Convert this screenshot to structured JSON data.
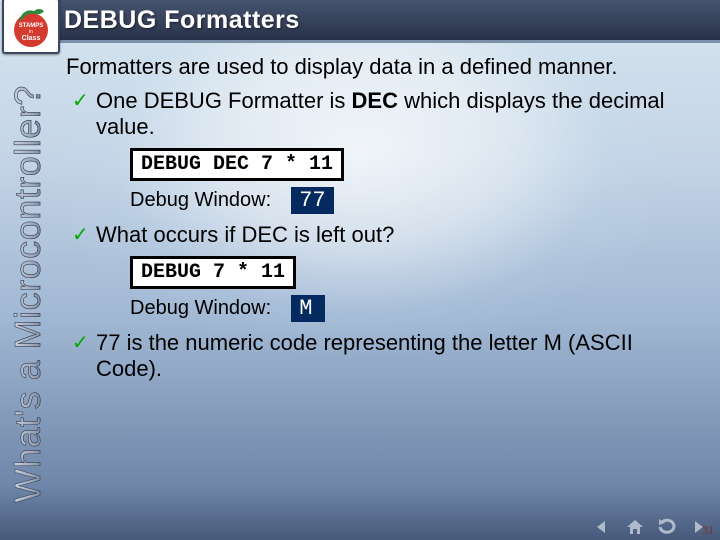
{
  "title": "DEBUG Formatters",
  "sidebar_text": "What's a Microcontroller?",
  "logo_label": "STAMPS in Class",
  "body": {
    "intro": "Formatters are used to display data in a defined manner.",
    "bullet1_a": "One DEBUG Formatter is ",
    "bullet1_bold": "DEC",
    "bullet1_b": " which displays the decimal value.",
    "code1": "DEBUG DEC 7 * 11",
    "dbg_label": "Debug Window:",
    "out1": "77",
    "bullet2": "What occurs if DEC is left out?",
    "code2": "DEBUG 7 * 11",
    "out2": "M",
    "bullet3": "77 is the numeric code representing the letter M (ASCII Code)."
  },
  "nav": {
    "prev_icon": "prev-icon",
    "home_icon": "home-icon",
    "loop_icon": "loop-icon",
    "next_icon": "next-icon"
  },
  "page_number": "31"
}
